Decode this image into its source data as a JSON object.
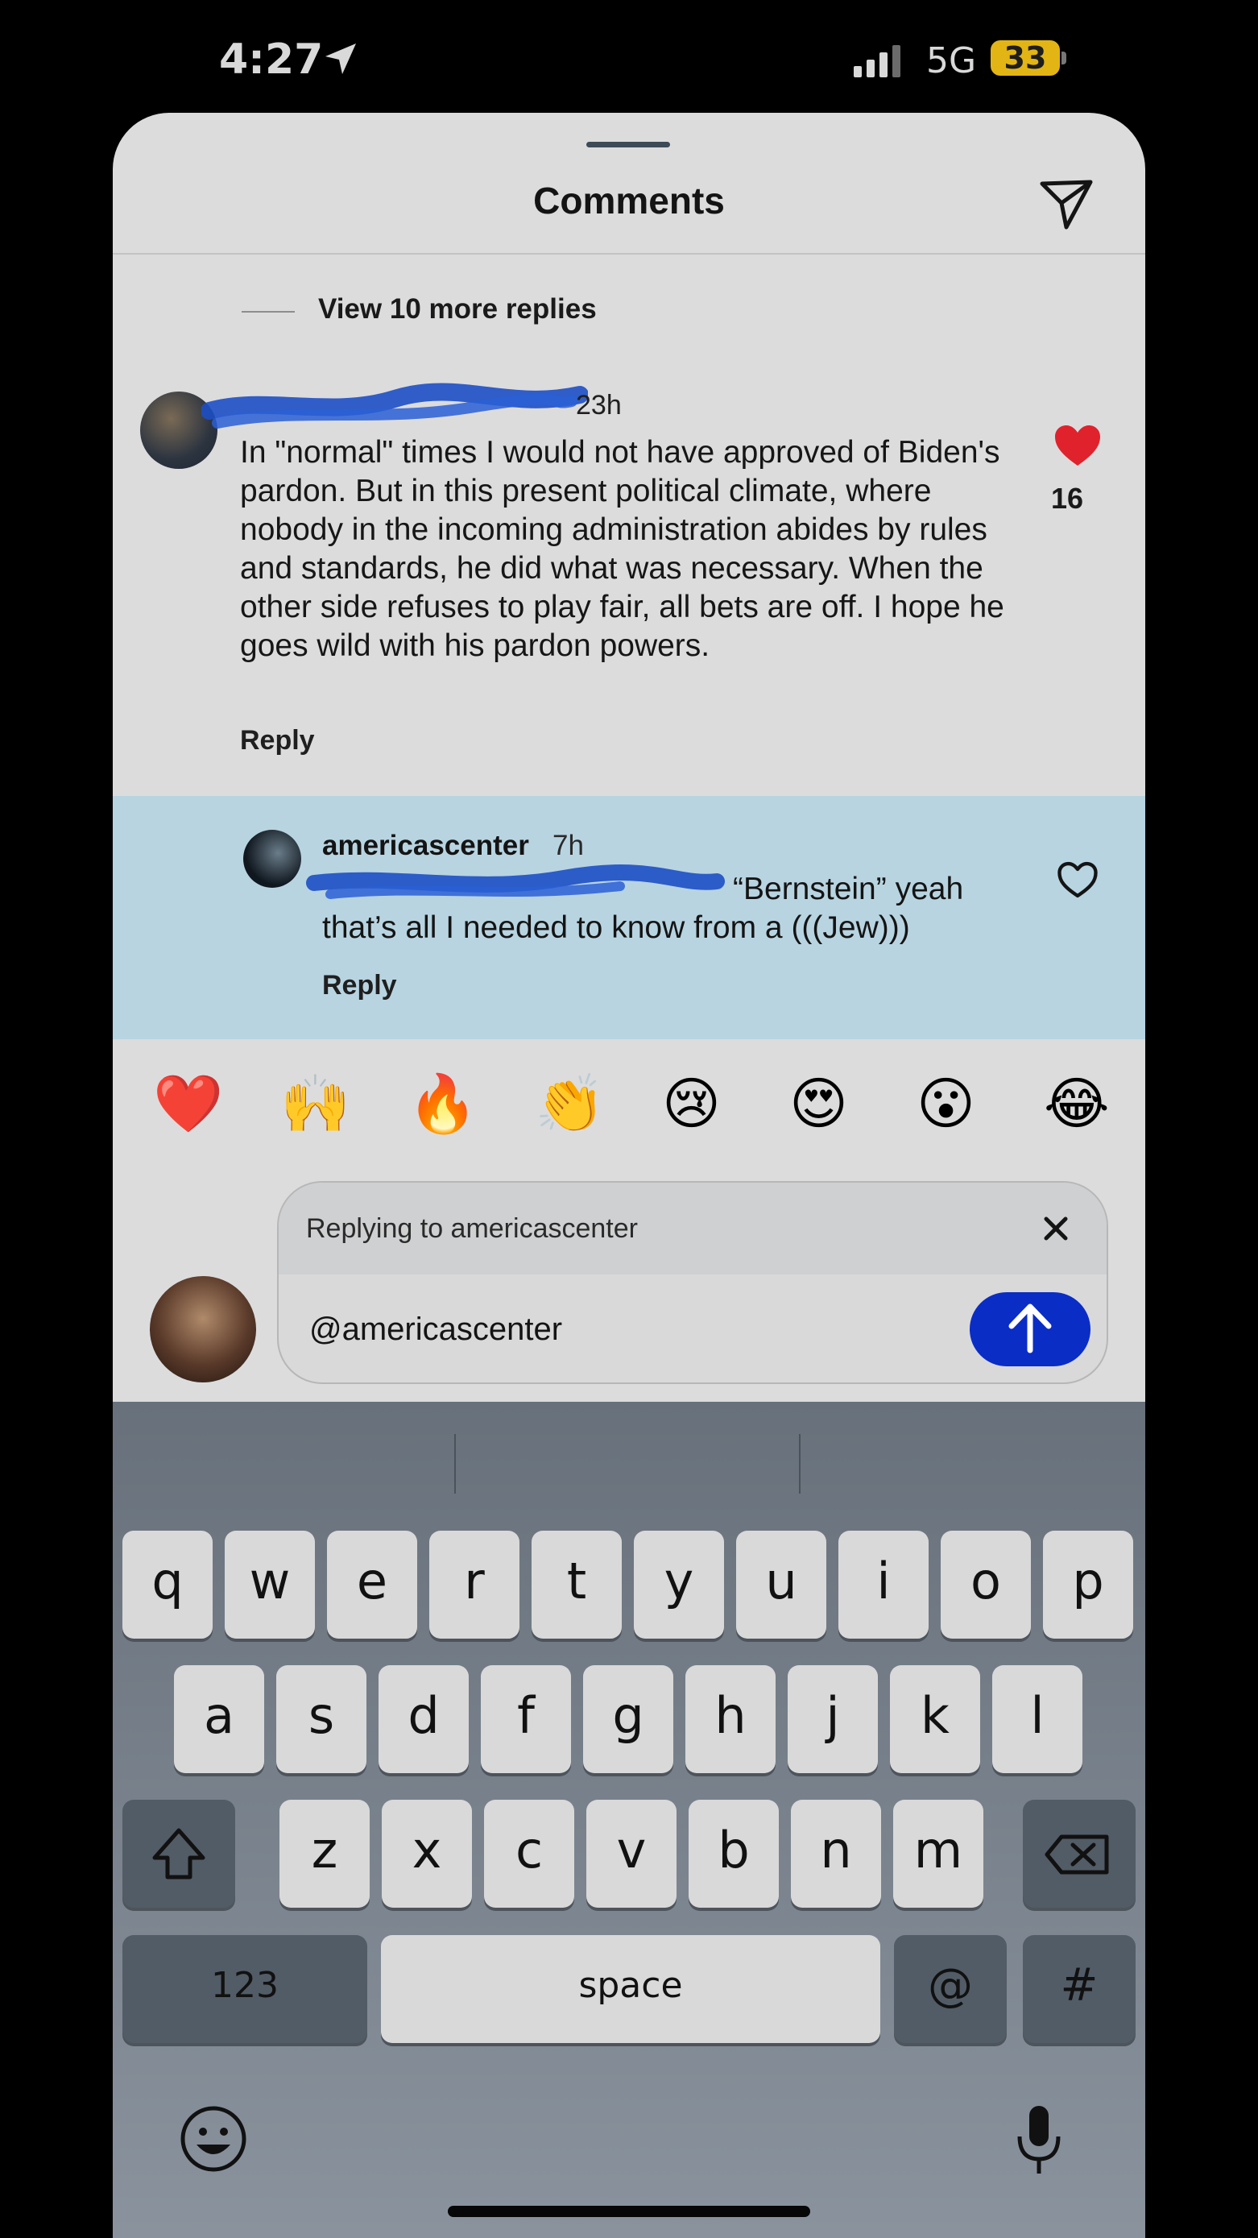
{
  "status_bar": {
    "time": "4:27",
    "network": "5G",
    "battery": "33"
  },
  "sheet": {
    "title": "Comments",
    "view_more": "View 10 more replies"
  },
  "comment1": {
    "time": "23h",
    "text": "In \"normal\" times I would not have approved of Biden's pardon. But in this present political climate, where nobody in the incoming administration abides by rules and standards, he did what was necessary. When the other side refuses to play fair, all bets are off. I hope he goes wild with his pardon powers.",
    "reply": "Reply",
    "likes": "16"
  },
  "comment2": {
    "username": "americascenter",
    "time": "7h",
    "line1": "“Bernstein” yeah",
    "line2": "that’s all I needed to know from a (((Jew)))",
    "reply": "Reply"
  },
  "emojis": [
    "❤️",
    "🙌",
    "🔥",
    "👏",
    "😢",
    "😍",
    "😮",
    "😂"
  ],
  "reply_box": {
    "replying_to": "Replying to americascenter",
    "input_value": "@americascenter"
  },
  "keyboard": {
    "row1": [
      "q",
      "w",
      "e",
      "r",
      "t",
      "y",
      "u",
      "i",
      "o",
      "p"
    ],
    "row2": [
      "a",
      "s",
      "d",
      "f",
      "g",
      "h",
      "j",
      "k",
      "l"
    ],
    "row3": [
      "z",
      "x",
      "c",
      "v",
      "b",
      "n",
      "m"
    ],
    "numbers": "123",
    "space": "space",
    "at": "@",
    "hash": "#"
  }
}
